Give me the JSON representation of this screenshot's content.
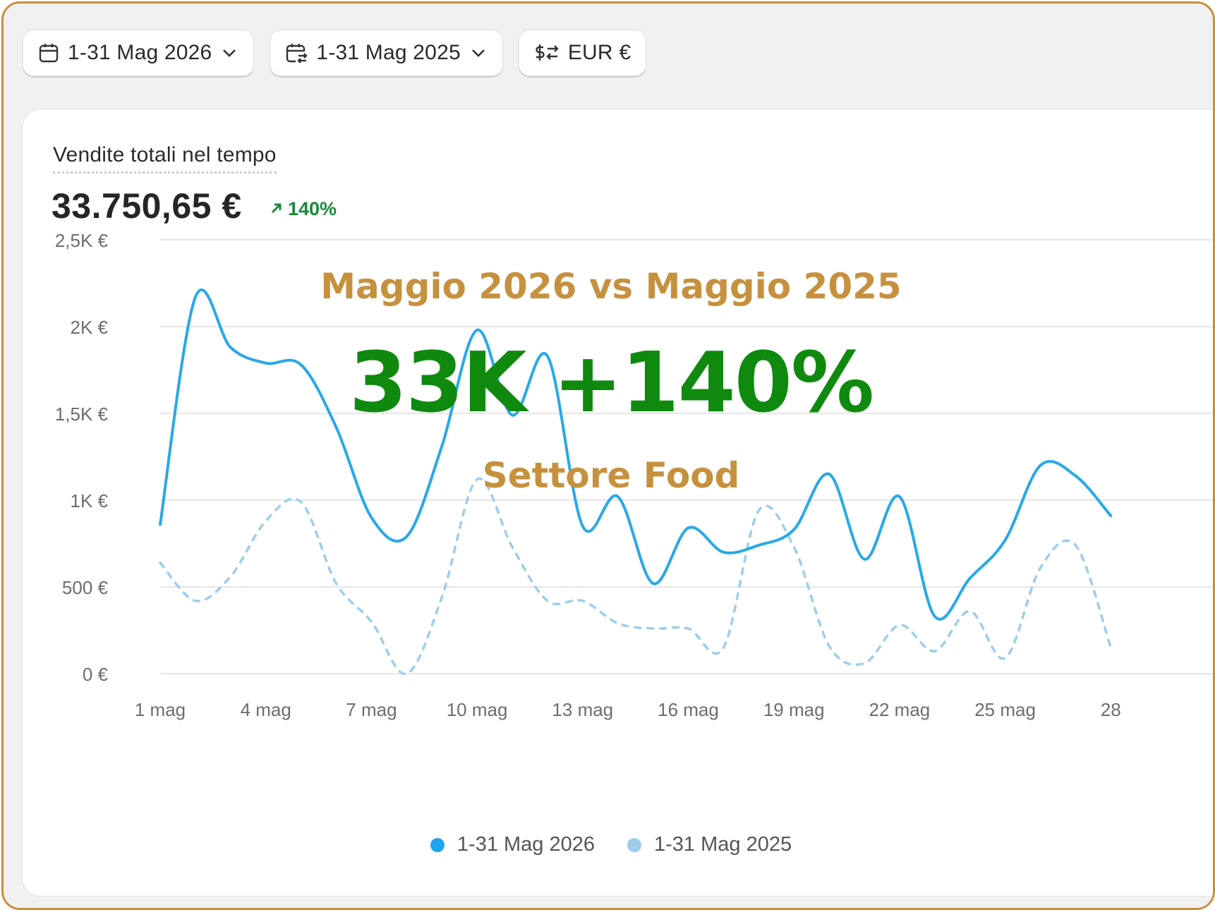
{
  "toolbar": {
    "date_range": "1-31 Mag 2026",
    "compare_range": "1-31 Mag 2025",
    "currency": "EUR €"
  },
  "metric": {
    "title": "Vendite totali nel tempo",
    "value": "33.750,65 €",
    "change": "140%"
  },
  "overlay": {
    "headline": "Maggio 2026 vs Maggio 2025",
    "big": "33K +140%",
    "sector": "Settore Food"
  },
  "colors": {
    "series_current": "#29a8e8",
    "series_previous": "#9dcdea",
    "accent_gold": "#c6913f",
    "accent_green": "#0f8a0f",
    "positive": "#1b8a3e"
  },
  "chart_data": {
    "type": "line",
    "ylim": [
      0,
      2500
    ],
    "yticks": [
      "0 €",
      "500 €",
      "1K €",
      "1,5K €",
      "2K €",
      "2,5K €"
    ],
    "xticks": [
      "1 mag",
      "4 mag",
      "7 mag",
      "10 mag",
      "13 mag",
      "16 mag",
      "19 mag",
      "22 mag",
      "25 mag",
      "28"
    ],
    "x": [
      1,
      2,
      3,
      4,
      5,
      6,
      7,
      8,
      9,
      10,
      11,
      12,
      13,
      14,
      15,
      16,
      17,
      18,
      19,
      20,
      21,
      22,
      23,
      24,
      25,
      26,
      27,
      28
    ],
    "series": [
      {
        "name": "1-31 Mag 2026",
        "style": "solid",
        "values": [
          860,
          2170,
          1880,
          1790,
          1780,
          1420,
          900,
          790,
          1310,
          1980,
          1490,
          1830,
          850,
          1020,
          520,
          840,
          700,
          740,
          830,
          1150,
          660,
          1020,
          330,
          550,
          770,
          1200,
          1140,
          910
        ]
      },
      {
        "name": "1-31 Mag 2025",
        "style": "dashed",
        "values": [
          640,
          420,
          560,
          880,
          990,
          520,
          300,
          0,
          440,
          1120,
          730,
          420,
          420,
          290,
          260,
          260,
          150,
          940,
          730,
          160,
          60,
          280,
          130,
          360,
          90,
          610,
          740,
          150
        ]
      }
    ]
  }
}
